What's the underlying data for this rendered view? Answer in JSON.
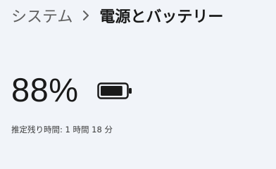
{
  "breadcrumb": {
    "parent": "システム",
    "separator_icon": "chevron-right-icon",
    "current": "電源とバッテリー"
  },
  "battery": {
    "percent_text": "88%",
    "level": 0.88,
    "icon": "battery-icon",
    "remaining_label": "推定残り時間:",
    "remaining_value": "1 時間 18 分"
  },
  "colors": {
    "background": "#f1f4f9",
    "text": "#1a1a1a",
    "secondary_text": "#5f5f5f"
  }
}
